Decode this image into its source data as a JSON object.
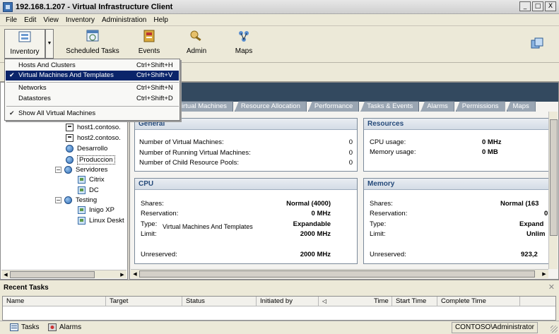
{
  "window": {
    "title": "192.168.1.207 - Virtual Infrastructure Client",
    "controls": [
      "_",
      "□",
      "X"
    ]
  },
  "menubar": [
    "File",
    "Edit",
    "View",
    "Inventory",
    "Administration",
    "Help"
  ],
  "toolbar": {
    "inventory": "Inventory",
    "scheduled_tasks": "Scheduled Tasks",
    "events": "Events",
    "admin": "Admin",
    "maps": "Maps"
  },
  "dropdown": {
    "items": [
      {
        "label": "Hosts And Clusters",
        "shortcut": "Ctrl+Shift+H"
      },
      {
        "label": "Virtual Machines And Templates",
        "shortcut": "Ctrl+Shift+V"
      },
      {
        "label": "Networks",
        "shortcut": "Ctrl+Shift+N"
      },
      {
        "label": "Datastores",
        "shortcut": "Ctrl+Shift+D"
      },
      {
        "label": "Show All Virtual Machines",
        "shortcut": ""
      }
    ]
  },
  "tree": {
    "items": [
      "host1.contoso.",
      "host2.contoso.",
      "Desarrollo",
      "Produccion",
      "Servidores",
      "Citrix",
      "DC",
      "Testing",
      "Inigo XP",
      "Linux Deskt"
    ]
  },
  "tabs": [
    "irtual Machines",
    "Resource Allocation",
    "Performance",
    "Tasks & Events",
    "Alarms",
    "Permissions",
    "Maps"
  ],
  "general": {
    "title": "General",
    "rows": [
      {
        "label": "Number of Virtual Machines:",
        "value": "0"
      },
      {
        "label": "Number of Running Virtual Machines:",
        "value": "0"
      },
      {
        "label": "Number of Child Resource Pools:",
        "value": "0"
      }
    ]
  },
  "resources": {
    "title": "Resources",
    "rows": [
      {
        "label": "CPU usage:",
        "value": "0 MHz"
      },
      {
        "label": "Memory usage:",
        "value": "0 MB"
      }
    ]
  },
  "cpu": {
    "title": "CPU",
    "rows": [
      {
        "label": "Shares:",
        "value": "Normal (4000)"
      },
      {
        "label": "Reservation:",
        "value": "0 MHz"
      },
      {
        "label": "Type:",
        "value": "Expandable"
      },
      {
        "label": "Limit:",
        "value": "2000 MHz"
      },
      {
        "label": "Unreserved:",
        "value": "2000 MHz"
      }
    ]
  },
  "memory": {
    "title": "Memory",
    "rows": [
      {
        "label": "Shares:",
        "value": "Normal (163"
      },
      {
        "label": "Reservation:",
        "value": "0"
      },
      {
        "label": "Type:",
        "value": "Expand"
      },
      {
        "label": "Limit:",
        "value": "Unlim"
      },
      {
        "label": "Unreserved:",
        "value": "923,2"
      }
    ]
  },
  "tooltip": "Virtual Machines And Templates",
  "recent_tasks": {
    "title": "Recent Tasks",
    "close": "✕",
    "columns": [
      "Name",
      "Target",
      "Status",
      "Initiated by",
      "Time",
      "Start Time",
      "Complete Time"
    ]
  },
  "statusbar": {
    "tasks": "Tasks",
    "alarms": "Alarms",
    "user": "CONTOSO\\Administrator"
  }
}
